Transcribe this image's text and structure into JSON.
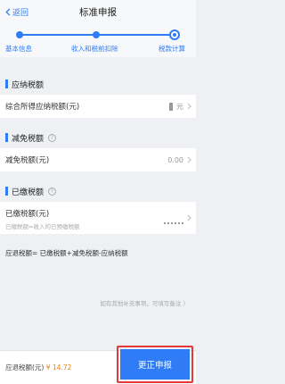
{
  "header": {
    "back_label": "返回",
    "title": "标准申报"
  },
  "stepper": {
    "steps": [
      {
        "label": "基本信息",
        "state": "done"
      },
      {
        "label": "收入和税前扣除",
        "state": "done"
      },
      {
        "label": "税款计算",
        "state": "current"
      }
    ],
    "accent": "#2f7cf6"
  },
  "payable": {
    "section_title": "应纳税额",
    "row_label": "综合所得应纳税额(元)",
    "row_value_suffix": "元"
  },
  "reduction": {
    "section_title": "减免税额",
    "row_label": "减免税额(元)",
    "row_value": "0.00"
  },
  "paid": {
    "section_title": "已缴税额",
    "row_label": "已缴税额(元)",
    "row_sub": "已缴税额=收入的已预缴税额"
  },
  "formula": "应退税额= 已缴税额+减免税额-应纳税额",
  "note": "如有其他补充事项，可填写备注 〉",
  "footer": {
    "amount_label": "应退税额(元)",
    "amount_value": "¥ 14.72",
    "submit_label": "更正申报",
    "highlight_color": "#e23a3a"
  }
}
